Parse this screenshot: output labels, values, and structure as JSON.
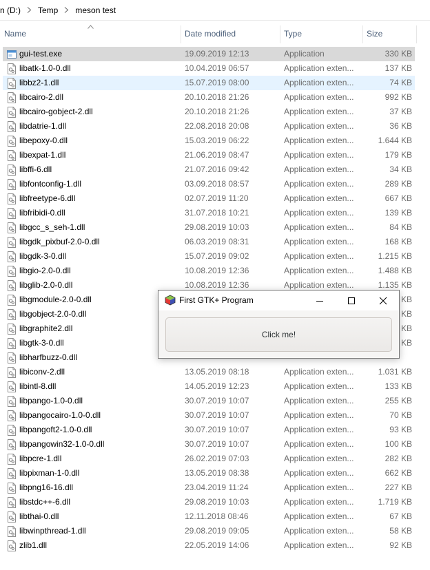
{
  "breadcrumb": [
    "n (D:)",
    "Temp",
    "meson test"
  ],
  "columns": {
    "name": "Name",
    "date": "Date modified",
    "type": "Type",
    "size": "Size"
  },
  "files": [
    {
      "name": "gui-test.exe",
      "date": "19.09.2019 12:13",
      "type": "Application",
      "size": "330 KB",
      "icon": "exe-icon"
    },
    {
      "name": "libatk-1.0-0.dll",
      "date": "10.04.2019 06:57",
      "type": "Application exten...",
      "size": "137 KB",
      "icon": "dll-icon"
    },
    {
      "name": "libbz2-1.dll",
      "date": "15.07.2019 08:00",
      "type": "Application exten...",
      "size": "74 KB",
      "icon": "dll-icon"
    },
    {
      "name": "libcairo-2.dll",
      "date": "20.10.2018 21:26",
      "type": "Application exten...",
      "size": "992 KB",
      "icon": "dll-icon"
    },
    {
      "name": "libcairo-gobject-2.dll",
      "date": "20.10.2018 21:26",
      "type": "Application exten...",
      "size": "37 KB",
      "icon": "dll-icon"
    },
    {
      "name": "libdatrie-1.dll",
      "date": "22.08.2018 20:08",
      "type": "Application exten...",
      "size": "36 KB",
      "icon": "dll-icon"
    },
    {
      "name": "libepoxy-0.dll",
      "date": "15.03.2019 06:22",
      "type": "Application exten...",
      "size": "1.644 KB",
      "icon": "dll-icon"
    },
    {
      "name": "libexpat-1.dll",
      "date": "21.06.2019 08:47",
      "type": "Application exten...",
      "size": "179 KB",
      "icon": "dll-icon"
    },
    {
      "name": "libffi-6.dll",
      "date": "21.07.2016 09:42",
      "type": "Application exten...",
      "size": "34 KB",
      "icon": "dll-icon"
    },
    {
      "name": "libfontconfig-1.dll",
      "date": "03.09.2018 08:57",
      "type": "Application exten...",
      "size": "289 KB",
      "icon": "dll-icon"
    },
    {
      "name": "libfreetype-6.dll",
      "date": "02.07.2019 11:20",
      "type": "Application exten...",
      "size": "667 KB",
      "icon": "dll-icon"
    },
    {
      "name": "libfribidi-0.dll",
      "date": "31.07.2018 10:21",
      "type": "Application exten...",
      "size": "139 KB",
      "icon": "dll-icon"
    },
    {
      "name": "libgcc_s_seh-1.dll",
      "date": "29.08.2019 10:03",
      "type": "Application exten...",
      "size": "84 KB",
      "icon": "dll-icon"
    },
    {
      "name": "libgdk_pixbuf-2.0-0.dll",
      "date": "06.03.2019 08:31",
      "type": "Application exten...",
      "size": "168 KB",
      "icon": "dll-icon"
    },
    {
      "name": "libgdk-3-0.dll",
      "date": "15.07.2019 09:02",
      "type": "Application exten...",
      "size": "1.215 KB",
      "icon": "dll-icon"
    },
    {
      "name": "libgio-2.0-0.dll",
      "date": "10.08.2019 12:36",
      "type": "Application exten...",
      "size": "1.488 KB",
      "icon": "dll-icon"
    },
    {
      "name": "libglib-2.0-0.dll",
      "date": "10.08.2019 12:36",
      "type": "Application exten...",
      "size": "1.135 KB",
      "icon": "dll-icon"
    },
    {
      "name": "libgmodule-2.0-0.dll",
      "date": "",
      "type": "",
      "size": "KB",
      "icon": "dll-icon"
    },
    {
      "name": "libgobject-2.0-0.dll",
      "date": "",
      "type": "",
      "size": "KB",
      "icon": "dll-icon"
    },
    {
      "name": "libgraphite2.dll",
      "date": "",
      "type": "",
      "size": "KB",
      "icon": "dll-icon"
    },
    {
      "name": "libgtk-3-0.dll",
      "date": "",
      "type": "",
      "size": "KB",
      "icon": "dll-icon"
    },
    {
      "name": "libharfbuzz-0.dll",
      "date": "",
      "type": "",
      "size": "",
      "icon": "dll-icon"
    },
    {
      "name": "libiconv-2.dll",
      "date": "13.05.2019 08:18",
      "type": "Application exten...",
      "size": "1.031 KB",
      "icon": "dll-icon"
    },
    {
      "name": "libintl-8.dll",
      "date": "14.05.2019 12:23",
      "type": "Application exten...",
      "size": "133 KB",
      "icon": "dll-icon"
    },
    {
      "name": "libpango-1.0-0.dll",
      "date": "30.07.2019 10:07",
      "type": "Application exten...",
      "size": "255 KB",
      "icon": "dll-icon"
    },
    {
      "name": "libpangocairo-1.0-0.dll",
      "date": "30.07.2019 10:07",
      "type": "Application exten...",
      "size": "70 KB",
      "icon": "dll-icon"
    },
    {
      "name": "libpangoft2-1.0-0.dll",
      "date": "30.07.2019 10:07",
      "type": "Application exten...",
      "size": "93 KB",
      "icon": "dll-icon"
    },
    {
      "name": "libpangowin32-1.0-0.dll",
      "date": "30.07.2019 10:07",
      "type": "Application exten...",
      "size": "100 KB",
      "icon": "dll-icon"
    },
    {
      "name": "libpcre-1.dll",
      "date": "26.02.2019 07:03",
      "type": "Application exten...",
      "size": "282 KB",
      "icon": "dll-icon"
    },
    {
      "name": "libpixman-1-0.dll",
      "date": "13.05.2019 08:38",
      "type": "Application exten...",
      "size": "662 KB",
      "icon": "dll-icon"
    },
    {
      "name": "libpng16-16.dll",
      "date": "23.04.2019 11:24",
      "type": "Application exten...",
      "size": "227 KB",
      "icon": "dll-icon"
    },
    {
      "name": "libstdc++-6.dll",
      "date": "29.08.2019 10:03",
      "type": "Application exten...",
      "size": "1.719 KB",
      "icon": "dll-icon"
    },
    {
      "name": "libthai-0.dll",
      "date": "12.11.2018 08:46",
      "type": "Application exten...",
      "size": "67 KB",
      "icon": "dll-icon"
    },
    {
      "name": "libwinpthread-1.dll",
      "date": "29.08.2019 09:05",
      "type": "Application exten...",
      "size": "58 KB",
      "icon": "dll-icon"
    },
    {
      "name": "zlib1.dll",
      "date": "22.05.2019 14:06",
      "type": "Application exten...",
      "size": "92 KB",
      "icon": "dll-icon"
    }
  ],
  "selected_row": 0,
  "hover_row": 2,
  "gtk_window": {
    "title": "First GTK+ Program",
    "button_label": "Click me!",
    "controls": [
      "minimize-icon",
      "maximize-icon",
      "close-icon"
    ]
  },
  "colors": {
    "selected": "#d9d9d9",
    "hover": "#e5f3ff",
    "header_text": "#4c607a",
    "secondary_text": "#6d6d6d"
  }
}
